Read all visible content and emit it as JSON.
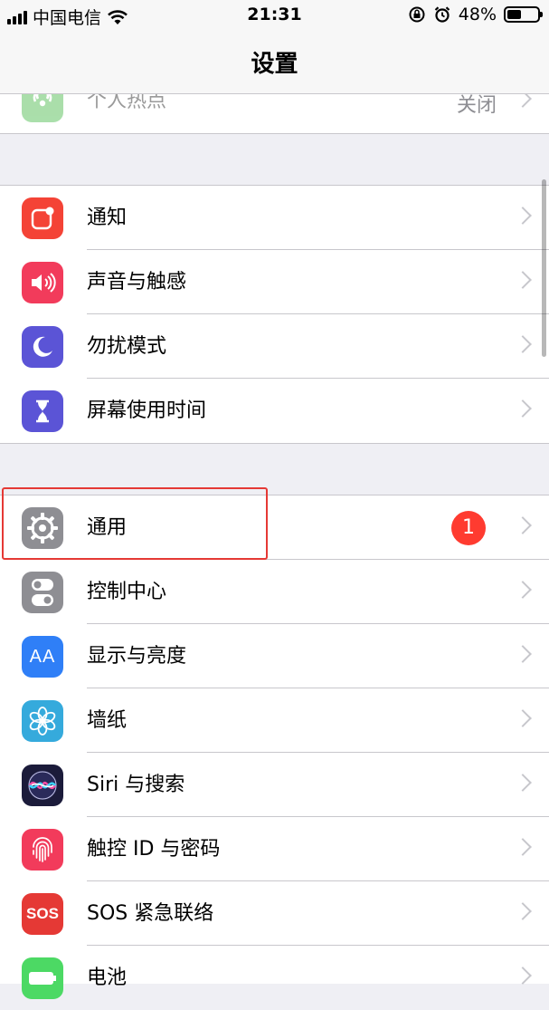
{
  "status_bar": {
    "carrier": "中国电信",
    "time": "21:31",
    "battery_percent": "48%",
    "battery_level": 0.48
  },
  "nav": {
    "title": "设置"
  },
  "groups": [
    {
      "items": [
        {
          "label": "个人热点",
          "value": "关闭",
          "icon": "hotspot-icon",
          "color": "#65c466"
        }
      ]
    },
    {
      "items": [
        {
          "label": "通知",
          "icon": "notifications-icon",
          "color": "#f44336"
        },
        {
          "label": "声音与触感",
          "icon": "speaker-icon",
          "color": "#f23b5b"
        },
        {
          "label": "勿扰模式",
          "icon": "moon-icon",
          "color": "#5b54d6"
        },
        {
          "label": "屏幕使用时间",
          "icon": "hourglass-icon",
          "color": "#5b54d6"
        }
      ]
    },
    {
      "items": [
        {
          "label": "通用",
          "badge": "1",
          "icon": "gear-icon",
          "color": "#8e8e93"
        },
        {
          "label": "控制中心",
          "icon": "toggles-icon",
          "color": "#8e8e93"
        },
        {
          "label": "显示与亮度",
          "icon": "text-size-icon",
          "color": "#2f7ff7"
        },
        {
          "label": "墙纸",
          "icon": "flower-icon",
          "color": "#35aadc"
        },
        {
          "label": "Siri 与搜索",
          "icon": "siri-icon",
          "color": "#1b1b3a"
        },
        {
          "label": "触控 ID 与密码",
          "icon": "fingerprint-icon",
          "color": "#f23b5b"
        },
        {
          "label": "SOS 紧急联络",
          "icon": "sos-icon",
          "color": "#e53935",
          "icon_text": "SOS"
        },
        {
          "label": "电池",
          "icon": "battery-icon",
          "color": "#4cd964"
        }
      ]
    }
  ],
  "icon_text": {
    "display": "AA"
  }
}
